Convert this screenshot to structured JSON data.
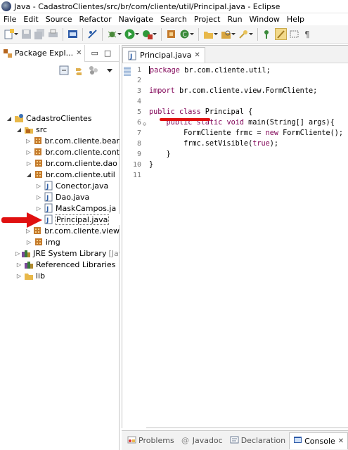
{
  "window": {
    "title": "Java - CadastroClientes/src/br/com/cliente/util/Principal.java - Eclipse"
  },
  "menu": [
    "File",
    "Edit",
    "Source",
    "Refactor",
    "Navigate",
    "Search",
    "Project",
    "Run",
    "Window",
    "Help"
  ],
  "package_explorer": {
    "tab_label": "Package Expl...",
    "close_glyph": "✕",
    "minimize_glyph": "▭",
    "maximize_glyph": "□",
    "tree": [
      {
        "label": "CadastroClientes",
        "depth": 0,
        "expanded": true,
        "icon": "project-icon"
      },
      {
        "label": "src",
        "depth": 1,
        "expanded": true,
        "icon": "source-folder-icon"
      },
      {
        "label": "br.com.cliente.bear",
        "depth": 2,
        "expanded": false,
        "icon": "package-icon"
      },
      {
        "label": "br.com.cliente.cont",
        "depth": 2,
        "expanded": false,
        "icon": "package-icon"
      },
      {
        "label": "br.com.cliente.dao",
        "depth": 2,
        "expanded": false,
        "icon": "package-icon"
      },
      {
        "label": "br.com.cliente.util",
        "depth": 2,
        "expanded": true,
        "icon": "package-icon"
      },
      {
        "label": "Conector.java",
        "depth": 3,
        "expanded": false,
        "icon": "java-file-icon"
      },
      {
        "label": "Dao.java",
        "depth": 3,
        "expanded": false,
        "icon": "java-file-icon"
      },
      {
        "label": "MaskCampos.ja",
        "depth": 3,
        "expanded": false,
        "icon": "java-file-icon"
      },
      {
        "label": "Principal.java",
        "depth": 3,
        "expanded": false,
        "icon": "java-file-icon",
        "selected": true
      },
      {
        "label": "br.com.cliente.view",
        "depth": 2,
        "expanded": false,
        "icon": "package-icon"
      },
      {
        "label": "img",
        "depth": 2,
        "expanded": false,
        "icon": "package-icon"
      },
      {
        "label": "JRE System Library",
        "suffix": "[Java",
        "depth": 1,
        "expanded": false,
        "icon": "library-icon"
      },
      {
        "label": "Referenced Libraries",
        "depth": 1,
        "expanded": false,
        "icon": "library-icon"
      },
      {
        "label": "lib",
        "depth": 1,
        "expanded": false,
        "icon": "folder-icon"
      }
    ]
  },
  "editor": {
    "tab_label": "Principal.java",
    "close_glyph": "✕",
    "lines": [
      {
        "n": "1",
        "parts": [
          [
            "kw",
            "package"
          ],
          [
            "t",
            " br.com.cliente.util;"
          ]
        ]
      },
      {
        "n": "2",
        "parts": []
      },
      {
        "n": "3",
        "parts": [
          [
            "kw",
            "import"
          ],
          [
            "t",
            " br.com.cliente.view.FormCliente;"
          ]
        ]
      },
      {
        "n": "4",
        "parts": []
      },
      {
        "n": "5",
        "parts": [
          [
            "kw",
            "public"
          ],
          [
            "t",
            " "
          ],
          [
            "kw",
            "class"
          ],
          [
            "t",
            " Principal {"
          ]
        ]
      },
      {
        "n": "6",
        "parts": [
          [
            "t",
            "    "
          ],
          [
            "kw",
            "public"
          ],
          [
            "t",
            " "
          ],
          [
            "kw",
            "static"
          ],
          [
            "t",
            " "
          ],
          [
            "kw",
            "void"
          ],
          [
            "t",
            " main(String[] args){"
          ]
        ]
      },
      {
        "n": "7",
        "parts": [
          [
            "t",
            "        FormCliente frmc = "
          ],
          [
            "kw",
            "new"
          ],
          [
            "t",
            " FormCliente();"
          ]
        ]
      },
      {
        "n": "8",
        "parts": [
          [
            "t",
            "        frmc.setVisible("
          ],
          [
            "kw",
            "true"
          ],
          [
            "t",
            ");"
          ]
        ]
      },
      {
        "n": "9",
        "parts": [
          [
            "t",
            "    }"
          ]
        ]
      },
      {
        "n": "10",
        "parts": [
          [
            "t",
            "}"
          ]
        ]
      },
      {
        "n": "11",
        "parts": []
      }
    ]
  },
  "bottom_tabs": [
    {
      "label": "Problems",
      "icon": "problems-icon",
      "active": false
    },
    {
      "label": "Javadoc",
      "icon": "at-icon",
      "active": false
    },
    {
      "label": "Declaration",
      "icon": "declaration-icon",
      "active": false
    },
    {
      "label": "Console",
      "icon": "console-icon",
      "active": true
    }
  ],
  "bottom_close_glyph": "✕",
  "colors": {
    "keyword": "#7f0055",
    "annotation_red": "#e01010",
    "package_brown": "#b5651d"
  }
}
